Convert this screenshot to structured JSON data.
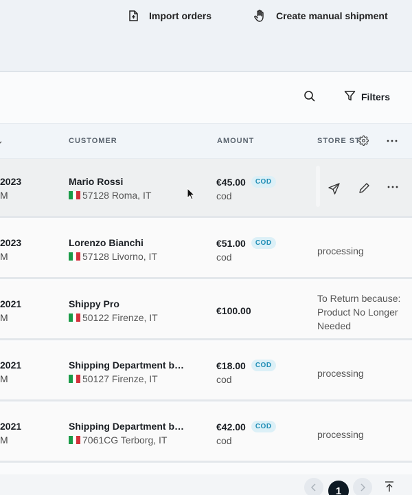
{
  "header": {
    "import_label": "Import orders",
    "manual_label": "Create manual shipment"
  },
  "toolbar": {
    "filters_label": "Filters"
  },
  "table": {
    "columns": {
      "customer": "CUSTOMER",
      "amount": "AMOUNT",
      "store_status": "STORE ST"
    },
    "rows": [
      {
        "date": "2023",
        "time": "M",
        "customer": "Mario Rossi",
        "address": "57128 Roma, IT",
        "amount": "€45.00",
        "badge": "COD",
        "payment": "cod",
        "status": ""
      },
      {
        "date": "2023",
        "time": "M",
        "customer": "Lorenzo Bianchi",
        "address": "57128 Livorno, IT",
        "amount": "€51.00",
        "badge": "COD",
        "payment": "cod",
        "status": "processing"
      },
      {
        "date": "2021",
        "time": "M",
        "customer": "Shippy Pro",
        "address": "50122 Firenze, IT",
        "amount": "€100.00",
        "badge": "",
        "payment": "",
        "status": "To Return because: Product No Longer Needed"
      },
      {
        "date": "2021",
        "time": "M",
        "customer": "Shipping Department by I…",
        "address": "50127 Firenze, IT",
        "amount": "€18.00",
        "badge": "COD",
        "payment": "cod",
        "status": "processing"
      },
      {
        "date": "2021",
        "time": "M",
        "customer": "Shipping Department by B…",
        "address": "7061CG Terborg, IT",
        "amount": "€42.00",
        "badge": "COD",
        "payment": "cod",
        "status": "processing"
      }
    ]
  },
  "pagination": {
    "current": "1"
  },
  "icons": {
    "import": "file-plus-icon",
    "manual": "hand-icon",
    "search": "search-icon",
    "filter": "filter-icon",
    "settings": "gear-icon",
    "more": "more-horizontal-icon",
    "send": "send-icon",
    "edit": "pencil-icon"
  },
  "colors": {
    "badge_bg": "#dcf0f7",
    "badge_text": "#1f8db5",
    "page_current": "#0e1a24"
  }
}
